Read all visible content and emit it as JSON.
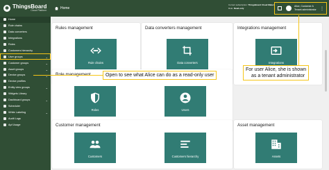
{
  "logo": {
    "title": "ThingsBoard",
    "subtitle": "Cloud Platform"
  },
  "sidebar": {
    "items": [
      {
        "label": "Home",
        "icon": "home-icon",
        "active": true
      },
      {
        "label": "Rule chains",
        "icon": "rule-chains-icon"
      },
      {
        "label": "Data converters",
        "icon": "data-converters-icon"
      },
      {
        "label": "Integrations",
        "icon": "integrations-icon"
      },
      {
        "label": "Roles",
        "icon": "roles-icon"
      },
      {
        "label": "Customers hierarchy",
        "icon": "customers-hierarchy-icon"
      },
      {
        "label": "User groups",
        "icon": "user-groups-icon",
        "chevron": "⌄",
        "highlight": true
      },
      {
        "label": "Customer groups",
        "icon": "customer-groups-icon",
        "chevron": "⌄"
      },
      {
        "label": "Asset groups",
        "icon": "asset-groups-icon",
        "chevron": "⌄"
      },
      {
        "label": "Device groups",
        "icon": "device-groups-icon",
        "chevron": "⌄"
      },
      {
        "label": "Device profiles",
        "icon": "device-profiles-icon"
      },
      {
        "label": "Entity view groups",
        "icon": "entity-view-groups-icon",
        "chevron": "⌄"
      },
      {
        "label": "Widgets Library",
        "icon": "widgets-library-icon"
      },
      {
        "label": "Dashboard groups",
        "icon": "dashboard-groups-icon",
        "chevron": "⌄"
      },
      {
        "label": "Scheduler",
        "icon": "scheduler-icon"
      },
      {
        "label": "White Labeling",
        "icon": "white-labeling-icon",
        "chevron": "⌄"
      },
      {
        "label": "Audit Logs",
        "icon": "audit-logs-icon"
      },
      {
        "label": "Api Usage",
        "icon": "api-usage-icon"
      }
    ]
  },
  "topbar": {
    "breadcrumb": "Home",
    "owner_label": "Current subscription:",
    "owner_value": "ThingsBoard Cloud Maker",
    "owner_label2": "Role:",
    "owner_value2": "Read-only",
    "user_name": "Alice, Customer A",
    "user_role": "Tenant administrator"
  },
  "cards": [
    {
      "key": "rules",
      "title": "Rules management",
      "tiles": [
        {
          "label": "Rule chains",
          "icon": "rule-chains-icon"
        }
      ]
    },
    {
      "key": "converters",
      "title": "Data converters management",
      "tiles": [
        {
          "label": "Data converters",
          "icon": "data-converters-icon"
        }
      ]
    },
    {
      "key": "integrations",
      "title": "Integrations management",
      "tiles": [
        {
          "label": "Integrations",
          "icon": "integrations-icon"
        }
      ]
    },
    {
      "key": "roles",
      "title": "Role management",
      "tiles": [
        {
          "label": "Roles",
          "icon": "roles-icon"
        },
        {
          "label": "Users",
          "icon": "users-icon"
        }
      ]
    },
    {
      "key": "customers",
      "title": "Customer management",
      "tiles": [
        {
          "label": "Customers",
          "icon": "customers-icon"
        },
        {
          "label": "Customers hierarchy",
          "icon": "customers-hierarchy-icon"
        }
      ]
    },
    {
      "key": "assets",
      "title": "Asset management",
      "tiles": [
        {
          "label": "Assets",
          "icon": "assets-icon"
        }
      ]
    }
  ],
  "callouts": {
    "read_only": "Open to see what Alice can do as a read-only user",
    "tenant_line1": "For user Alice, she is shown",
    "tenant_line2": "as a tenant administrator"
  },
  "colors": {
    "sidebar": "#304e35",
    "tile": "#317c74",
    "callout_border": "#f5c518"
  }
}
